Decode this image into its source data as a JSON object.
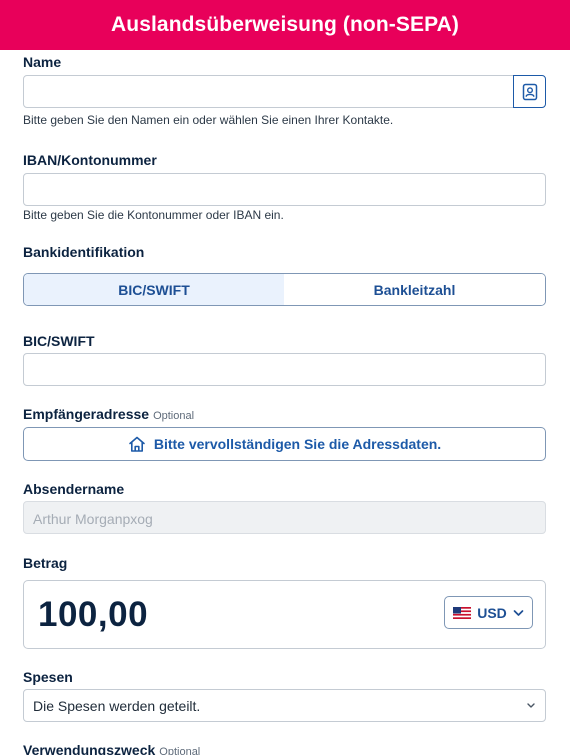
{
  "header": {
    "title": "Auslandsüberweisung (non-SEPA)"
  },
  "name": {
    "label": "Name",
    "value": "",
    "hint": "Bitte geben Sie den Namen ein oder wählen Sie einen Ihrer Kontakte.",
    "contact_icon": "contact-book-icon"
  },
  "iban": {
    "label": "IBAN/Kontonummer",
    "value": "",
    "hint": "Bitte geben Sie die Kontonummer oder IBAN ein."
  },
  "bank_identification": {
    "label": "Bankidentifikation",
    "options": [
      "BIC/SWIFT",
      "Bankleitzahl"
    ],
    "selected": "BIC/SWIFT"
  },
  "bic": {
    "label": "BIC/SWIFT",
    "value": ""
  },
  "address": {
    "label": "Empfängeradresse",
    "optional": "Optional",
    "button_label": "Bitte vervollständigen Sie die Adressdaten.",
    "icon": "home-icon"
  },
  "sender": {
    "label": "Absendername",
    "value": "Arthur Morganpxog"
  },
  "amount": {
    "label": "Betrag",
    "value": "100,00",
    "currency": "USD",
    "flag_icon": "us-flag-icon"
  },
  "fees": {
    "label": "Spesen",
    "selected": "Die Spesen werden geteilt."
  },
  "purpose": {
    "label": "Verwendungszweck",
    "optional": "Optional"
  },
  "colors": {
    "brand": "#e8005a",
    "accent": "#1d5aa8",
    "text": "#0c2340"
  }
}
